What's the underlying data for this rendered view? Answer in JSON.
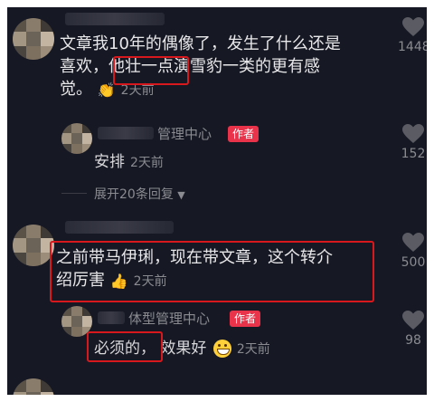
{
  "comments": [
    {
      "line1": "文章我10年的偶像了，发生了什么还是",
      "line2_pre": "喜欢，",
      "line2_hl": "他壮一点",
      "line2_post": "演雪豹一类的更有感",
      "line3": "觉。",
      "time": "2天前",
      "likes": "1448"
    },
    {
      "line1": "之前带马伊琍，现在带文章，这个转介",
      "line2": "绍厉害",
      "time": "2天前",
      "likes": "500"
    }
  ],
  "replies": [
    {
      "name": "管理中心",
      "tag": "作者",
      "text": "安排",
      "time": "2天前",
      "likes": "152"
    },
    {
      "name": "体型管理中心",
      "tag": "作者",
      "text_hl": "必须的，",
      "text_post": "效果好",
      "time": "2天前",
      "likes": "98"
    }
  ],
  "expand_label": "展开20条回复",
  "icons": {
    "like": "heart-icon",
    "expand": "triangle-down-icon",
    "clap": "clapping-hands-emoji",
    "thumb": "thumbs-up-emoji",
    "grin": "grinning-face-emoji"
  },
  "colors": {
    "background": "#161823",
    "text": "#e8e8ea",
    "muted": "#8a8b91",
    "author_tag": "#e8334a",
    "highlight_box": "#d7191e"
  }
}
